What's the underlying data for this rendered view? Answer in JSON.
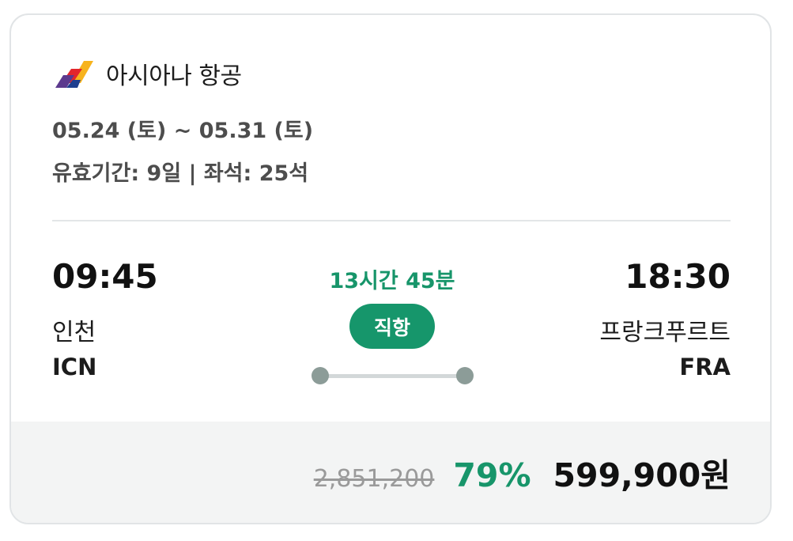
{
  "airline": {
    "name": "아시아나 항공",
    "logo_icon": "asiana-airlines-logo-icon",
    "logo_colors": [
      "#f7b31d",
      "#e3262c",
      "#5c3a8e",
      "#1f3f8f"
    ]
  },
  "trip": {
    "dates": "05.24 (토) ~ 05.31 (토)",
    "meta": "유효기간: 9일 | 좌석: 25석"
  },
  "departure": {
    "time": "09:45",
    "city": "인천",
    "code": "ICN"
  },
  "arrival": {
    "time": "18:30",
    "city": "프랑크푸르트",
    "code": "FRA"
  },
  "flight": {
    "duration": "13시간 45분",
    "type_badge": "직항"
  },
  "price": {
    "original": "2,851,200",
    "discount": "79%",
    "final": "599,900원"
  },
  "colors": {
    "accent_green": "#17956a",
    "badge_green": "#16966b",
    "price_bar_bg": "#f3f4f4",
    "route_dot": "#8c9c98"
  }
}
